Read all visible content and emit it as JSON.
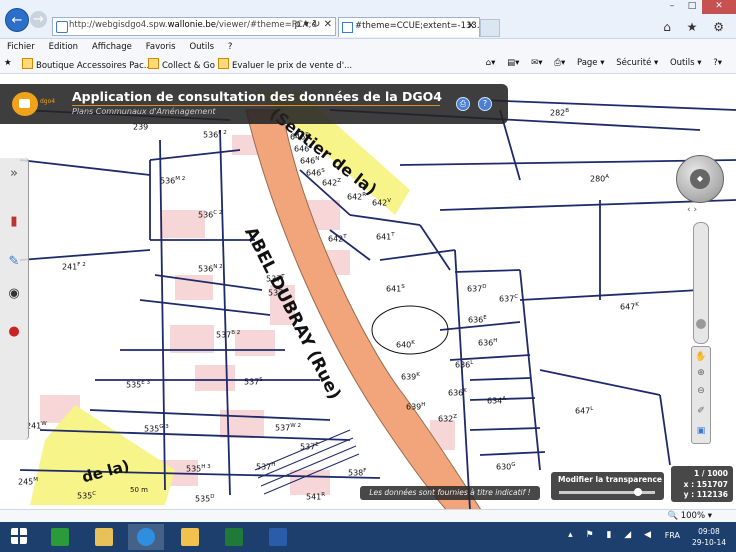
{
  "browser": {
    "address_prefix": "http://webgisdgo4.spw.",
    "address_domain": "wallonie.be",
    "address_suffix": "/viewer/#theme=PCA;e",
    "address_tools": "ρ ▾ ↻ ✕",
    "tab_title": "#theme=CCUE;extent=-133...",
    "tab_close": "×",
    "right_icons": "⌂ ★ ⚙",
    "min": "–",
    "max": "□",
    "close": "✕"
  },
  "menu": [
    "Fichier",
    "Edition",
    "Affichage",
    "Favoris",
    "Outils",
    "?"
  ],
  "favorites": [
    "Boutique Accessoires Pac...",
    "Collect & Go",
    "Evaluer le prix de vente d'..."
  ],
  "commandbar": [
    "Page ▾",
    "Sécurité ▾",
    "Outils ▾"
  ],
  "app": {
    "title": "Application de consultation des données de la DGO4",
    "subtitle": "Plans Communaux d'Aménagement",
    "logo_text": "dgo4"
  },
  "map": {
    "streets": [
      {
        "text": "ABEL DUBRAY  (Rue)"
      },
      {
        "text": "(Sentier de la)"
      },
      {
        "text": "de  la)"
      }
    ],
    "parcels": [
      {
        "n": "282",
        "s": "B"
      },
      {
        "n": "280",
        "s": "A"
      },
      {
        "n": "536",
        "s": "F 2"
      },
      {
        "n": "536",
        "s": "M 2"
      },
      {
        "n": "536",
        "s": "C 2"
      },
      {
        "n": "536",
        "s": "N 2"
      },
      {
        "n": "241",
        "s": "F 2"
      },
      {
        "n": "537",
        "s": "B 2"
      },
      {
        "n": "537",
        "s": "S"
      },
      {
        "n": "535",
        "s": "E 3"
      },
      {
        "n": "535",
        "s": "G 3"
      },
      {
        "n": "537",
        "s": "W 2"
      },
      {
        "n": "537",
        "s": "E"
      },
      {
        "n": "537",
        "s": "H"
      },
      {
        "n": "241",
        "s": "W"
      },
      {
        "n": "245",
        "s": "M"
      },
      {
        "n": "535",
        "s": "H 3"
      },
      {
        "n": "535",
        "s": "C"
      },
      {
        "n": "535",
        "s": "D"
      },
      {
        "n": "538",
        "s": "F"
      },
      {
        "n": "541",
        "s": "R"
      },
      {
        "n": "646",
        "s": "P"
      },
      {
        "n": "646",
        "s": "L"
      },
      {
        "n": "646",
        "s": "N"
      },
      {
        "n": "646",
        "s": "S"
      },
      {
        "n": "642",
        "s": "Z"
      },
      {
        "n": "642",
        "s": "R"
      },
      {
        "n": "642",
        "s": "V"
      },
      {
        "n": "642",
        "s": "T"
      },
      {
        "n": "641",
        "s": "T"
      },
      {
        "n": "641",
        "s": "S"
      },
      {
        "n": "637",
        "s": "D"
      },
      {
        "n": "637",
        "s": "C"
      },
      {
        "n": "636",
        "s": "E"
      },
      {
        "n": "636",
        "s": "H"
      },
      {
        "n": "640",
        "s": "K"
      },
      {
        "n": "639",
        "s": "K"
      },
      {
        "n": "636",
        "s": "L"
      },
      {
        "n": "636",
        "s": "K"
      },
      {
        "n": "639",
        "s": "H"
      },
      {
        "n": "632",
        "s": "Z"
      },
      {
        "n": "634",
        "s": "A"
      },
      {
        "n": "630",
        "s": "G"
      },
      {
        "n": "647",
        "s": "K"
      },
      {
        "n": "647",
        "s": "L"
      },
      {
        "n": "239",
        "s": ""
      },
      {
        "n": "537",
        "s": ""
      },
      {
        "n": "537",
        "s": "T"
      }
    ],
    "credit": "Les données sont fournies à titre indicatif !",
    "transparency_label": "Modifier la transparence",
    "transparency": 0.82,
    "scale": "1 / 1000",
    "x": "x : 151707",
    "y": "y : 112136",
    "scale_small": "50 m"
  },
  "status": {
    "zoom": "🔍 100%  ▾"
  },
  "taskbar": {
    "lang": "FRA",
    "time": "09:08",
    "date": "29-10-14",
    "tray": "▴ ⚑ ▮ ◢ ◀"
  }
}
